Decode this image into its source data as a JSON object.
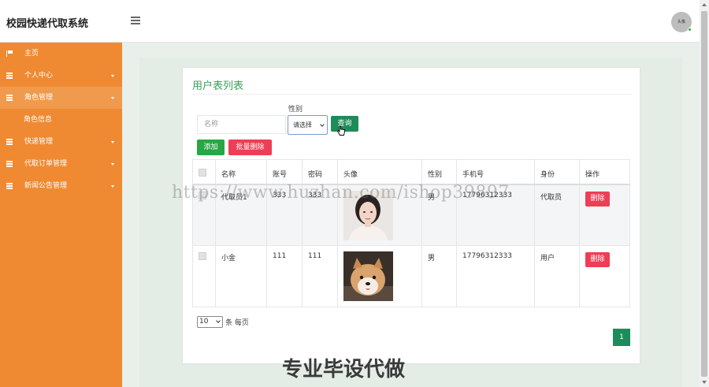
{
  "header": {
    "app_title": "校园快递代取系统",
    "avatar_text": "头像"
  },
  "sidebar": {
    "items": [
      {
        "label": "主页"
      },
      {
        "label": "个人中心"
      },
      {
        "label": "角色管理"
      },
      {
        "label": "角色信息"
      },
      {
        "label": "快递管理"
      },
      {
        "label": "代取订单管理"
      },
      {
        "label": "新闻公告管理"
      }
    ]
  },
  "main": {
    "title": "用户表列表",
    "filters": {
      "name_placeholder": "名称",
      "gender_label": "性别",
      "gender_selected": "请选择",
      "search_label": "查询"
    },
    "actions": {
      "add_label": "添加",
      "batch_delete_label": "批量删除"
    },
    "table": {
      "columns": [
        "名称",
        "账号",
        "密码",
        "头像",
        "性别",
        "手机号",
        "身份",
        "操作"
      ],
      "rows": [
        {
          "name": "代取员1",
          "account": "333",
          "password": "333",
          "gender": "男",
          "phone": "17796312333",
          "role": "代取员",
          "delete_label": "删除"
        },
        {
          "name": "小金",
          "account": "111",
          "password": "111",
          "gender": "男",
          "phone": "17796312333",
          "role": "用户",
          "delete_label": "删除"
        }
      ]
    },
    "pagination": {
      "page_size": "10",
      "page_size_suffix": "条 每页",
      "current_page": "1"
    }
  },
  "overlay": {
    "watermark": "https://www.huzhan.com/ishop39897",
    "bottom_caption": "专业毕设代做"
  },
  "colors": {
    "sidebar": "#ef8a32",
    "accent_green": "#1e8b5a",
    "danger": "#ee3e56",
    "title_green": "#3aa05a"
  }
}
